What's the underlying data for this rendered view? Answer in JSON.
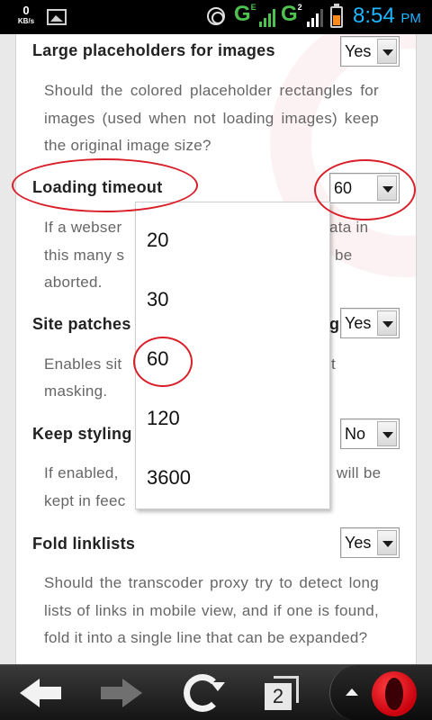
{
  "status_bar": {
    "data_rate_value": "0",
    "data_rate_unit": "KB/s",
    "network_1": "G",
    "network_1_badge": "E",
    "network_2": "G",
    "network_2_badge": "2",
    "time": "8:54",
    "ampm": "PM"
  },
  "settings": [
    {
      "label": "Large placeholders for images",
      "value": "Yes",
      "description": "Should the colored placeholder rectangles for images (used when not loading images) keep the original image size?"
    },
    {
      "label": "Loading timeout",
      "value": "60",
      "description_start": "If a webser",
      "description_end_1": "ata in",
      "description_mid": "this many s",
      "description_end_2": "be",
      "description_tail": "aborted."
    },
    {
      "label": "Site patches",
      "label_tail": "g",
      "value": "Yes",
      "description_start": "Enables sit",
      "description_end": "t",
      "description_tail": "masking."
    },
    {
      "label": "Keep styling",
      "value": "No",
      "description_start": "If enabled,",
      "description_end": "will be",
      "description_tail": "kept in feec"
    },
    {
      "label": "Fold linklists",
      "value": "Yes",
      "description": "Should the transcoder proxy try to detect long lists of links in mobile view, and if one is found, fold it into a single line that can be expanded?"
    }
  ],
  "dropdown": {
    "options": [
      "20",
      "30",
      "60",
      "120",
      "3600"
    ],
    "selected": "60"
  },
  "toolbar": {
    "tab_count": "2"
  },
  "colors": {
    "annotation": "#d9202a",
    "clock": "#1fb6ff",
    "signal_green": "#4ec24e",
    "battery": "#ff8a1e",
    "opera_red": "#e0121f"
  },
  "icons": [
    "image-notification-icon",
    "sync-globe-icon",
    "signal-icon",
    "battery-icon",
    "back-arrow-icon",
    "forward-arrow-icon",
    "reload-icon",
    "tabs-icon",
    "menu-up-icon",
    "opera-logo-icon"
  ]
}
